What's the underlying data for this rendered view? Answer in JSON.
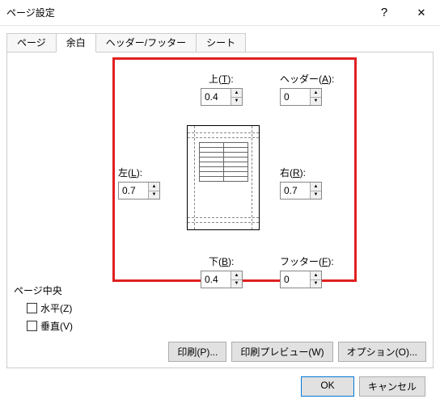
{
  "window": {
    "title": "ページ設定"
  },
  "tabs": {
    "page": "ページ",
    "margins": "余白",
    "headerfooter": "ヘッダー/フッター",
    "sheet": "シート"
  },
  "margins": {
    "top": {
      "label_pre": "上(",
      "key": "T",
      "label_post": "):",
      "value": "0.4"
    },
    "header": {
      "label_pre": "ヘッダー(",
      "key": "A",
      "label_post": "):",
      "value": "0"
    },
    "left": {
      "label_pre": "左(",
      "key": "L",
      "label_post": "):",
      "value": "0.7"
    },
    "right": {
      "label_pre": "右(",
      "key": "R",
      "label_post": "):",
      "value": "0.7"
    },
    "bottom": {
      "label_pre": "下(",
      "key": "B",
      "label_post": "):",
      "value": "0.4"
    },
    "footer": {
      "label_pre": "フッター(",
      "key": "F",
      "label_post": "):",
      "value": "0"
    }
  },
  "center_group": {
    "title": "ページ中央",
    "horizontal": {
      "label_pre": "水平(",
      "key": "Z",
      "label_post": ")"
    },
    "vertical": {
      "label_pre": "垂直(",
      "key": "V",
      "label_post": ")"
    }
  },
  "buttons": {
    "print": {
      "pre": "印刷(",
      "key": "P",
      "post": ")..."
    },
    "preview": {
      "pre": "印刷プレビュー(",
      "key": "W",
      "post": ")"
    },
    "options": {
      "pre": "オプション(",
      "key": "O",
      "post": ")..."
    }
  },
  "footer": {
    "ok": "OK",
    "cancel": "キャンセル"
  }
}
